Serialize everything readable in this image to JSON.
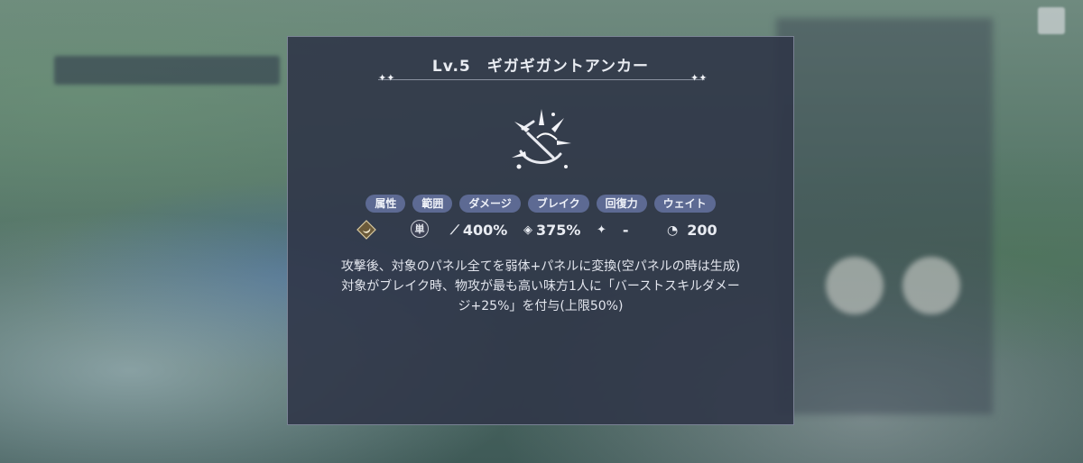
{
  "skill": {
    "title": "Lv.5　ギガギガントアンカー",
    "icon": "anchor-splash-icon"
  },
  "tags": [
    "属性",
    "範囲",
    "ダメージ",
    "ブレイク",
    "回復力",
    "ウェイト"
  ],
  "stats": {
    "attribute_icon": "crescent-moon-diamond-icon",
    "range_label": "単",
    "damage": "400%",
    "break": "375%",
    "heal": "-",
    "wait": "200"
  },
  "description": [
    "攻撃後、対象のパネル全てを弱体+パネルに変換(空パネルの時は生成)",
    "対象がブレイク時、物攻が最も高い味方1人に「バーストスキルダメー",
    "ジ+25%」を付与(上限50%)"
  ]
}
